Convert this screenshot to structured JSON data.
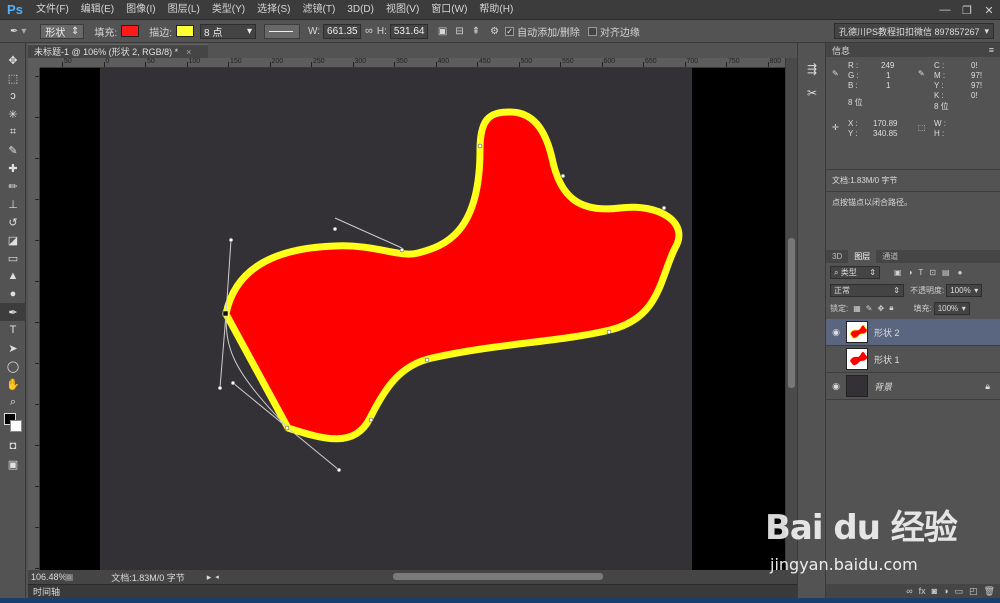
{
  "app": {
    "logo": "Ps"
  },
  "menu": [
    "文件(F)",
    "编辑(E)",
    "图像(I)",
    "图层(L)",
    "类型(Y)",
    "选择(S)",
    "滤镜(T)",
    "3D(D)",
    "视图(V)",
    "窗口(W)",
    "帮助(H)"
  ],
  "options": {
    "mode": "形状",
    "fill_label": "填充:",
    "fill_color": "#ff1a1a",
    "stroke_label": "描边:",
    "stroke_color": "#ffff33",
    "stroke_width": "8 点",
    "w_label": "W:",
    "w_value": "661.35",
    "h_label": "H:",
    "h_value": "531.64",
    "auto_add_delete": "自动添加/删除",
    "align_edges": "对齐边缘",
    "workspace": "孔德川PS教程扣扣微信 897857267"
  },
  "document": {
    "tab_title": "未标题-1 @ 106% (形状 2, RGB/8) *",
    "zoom": "106.48%",
    "doc_size": "文档:1.83M/0 字节",
    "timeline": "时间轴"
  },
  "ruler_top": [
    "50",
    "0",
    "50",
    "100",
    "150",
    "200",
    "250",
    "300",
    "350",
    "400",
    "450",
    "500",
    "550",
    "600",
    "650",
    "700",
    "750",
    "800"
  ],
  "info": {
    "title": "信息",
    "r": "249",
    "g": "1",
    "b": "1",
    "c": "0!",
    "m": "97!",
    "y": "97!",
    "k": "0!",
    "bits_left": "8 位",
    "bits_right": "8 位",
    "x": "170.89",
    "y_pos": "340.85",
    "doc_size": "文档:1.83M/0 字节",
    "hint": "点按锚点以闭合路径。"
  },
  "layers": {
    "tabs": [
      "3D",
      "图层",
      "通道"
    ],
    "filter": "类型",
    "blend_mode": "正常",
    "opacity_label": "不透明度:",
    "opacity": "100%",
    "lock_label": "锁定:",
    "fill_label": "填充:",
    "fill": "100%",
    "items": [
      {
        "name": "形状 2",
        "visible": true,
        "selected": true
      },
      {
        "name": "形状 1",
        "visible": false,
        "selected": false
      },
      {
        "name": "背景",
        "visible": true,
        "selected": false,
        "locked": true
      }
    ]
  },
  "watermark": {
    "brand": "Bai du 经验",
    "url": "jingyan.baidu.com"
  }
}
